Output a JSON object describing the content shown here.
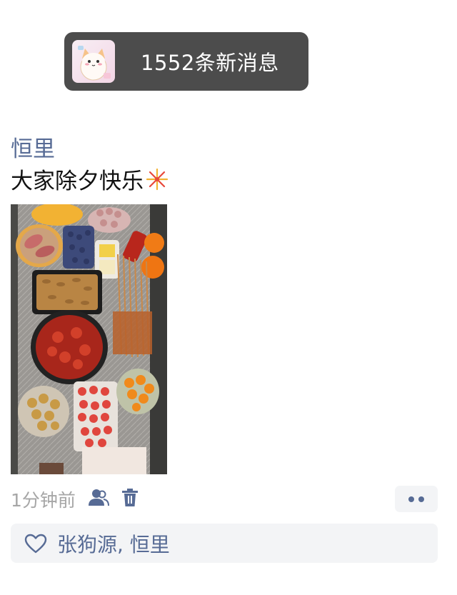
{
  "toast": {
    "text": "1552条新消息",
    "avatar_icon": "cartoon-cat-avatar"
  },
  "post": {
    "author": "恒里",
    "content": "大家除夕快乐",
    "content_emoji": "fireworks-emoji",
    "photo_subject": "new-year-eve-food-spread",
    "time": "1分钟前",
    "visibility_icon": "friends-visibility-icon",
    "delete_icon": "trash-icon",
    "more_icon": "more-dots-icon"
  },
  "likes": {
    "icon": "heart-outline-icon",
    "names": "张狗源, 恒里"
  },
  "colors": {
    "link": "#576b95",
    "toast_bg": "#4c4c4c",
    "muted": "#a6a6a6",
    "panel": "#f3f4f6"
  }
}
